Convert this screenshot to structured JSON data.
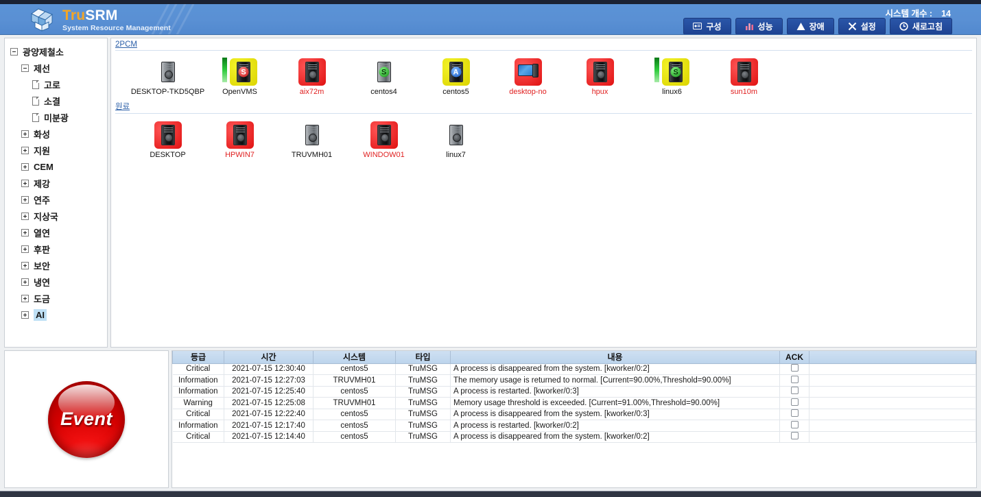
{
  "header": {
    "brand_tru": "Tru",
    "brand_srm": "SRM",
    "brand_sub": "System Resource Management",
    "system_count_label": "시스템 개수 :",
    "system_count_value": "14",
    "buttons": [
      {
        "label": "구성",
        "icon": "screen-icon",
        "active": false
      },
      {
        "label": "성능",
        "icon": "bar-chart-icon",
        "active": false
      },
      {
        "label": "장애",
        "icon": "warning-triangle-icon",
        "active": false
      },
      {
        "label": "설정",
        "icon": "tools-icon",
        "active": false
      },
      {
        "label": "새로고침",
        "icon": "refresh-icon",
        "active": true
      }
    ],
    "accent_color": "#5b93d6",
    "button_color": "#2a56a8",
    "active_underline_color": "#3ea8ff"
  },
  "sidebar": {
    "items": [
      {
        "label": "광양제철소",
        "level": 1,
        "marker": "minus",
        "selected": false
      },
      {
        "label": "제선",
        "level": 2,
        "marker": "minus",
        "selected": false
      },
      {
        "label": "고로",
        "level": 3,
        "marker": "document",
        "selected": false
      },
      {
        "label": "소결",
        "level": 3,
        "marker": "document",
        "selected": false
      },
      {
        "label": "미분광",
        "level": 3,
        "marker": "document",
        "selected": false
      },
      {
        "label": "화성",
        "level": 2,
        "marker": "plus",
        "selected": false
      },
      {
        "label": "지원",
        "level": 2,
        "marker": "plus",
        "selected": false
      },
      {
        "label": "CEM",
        "level": 2,
        "marker": "plus",
        "selected": false
      },
      {
        "label": "제강",
        "level": 2,
        "marker": "plus",
        "selected": false
      },
      {
        "label": "연주",
        "level": 2,
        "marker": "plus",
        "selected": false
      },
      {
        "label": "지상국",
        "level": 2,
        "marker": "plus",
        "selected": false
      },
      {
        "label": "열연",
        "level": 2,
        "marker": "plus",
        "selected": false
      },
      {
        "label": "후판",
        "level": 2,
        "marker": "plus",
        "selected": false
      },
      {
        "label": "보안",
        "level": 2,
        "marker": "plus",
        "selected": false
      },
      {
        "label": "냉연",
        "level": 2,
        "marker": "plus",
        "selected": false
      },
      {
        "label": "도금",
        "level": 2,
        "marker": "plus",
        "selected": false
      },
      {
        "label": "AI",
        "level": 2,
        "marker": "plus",
        "selected": true
      }
    ],
    "selection_color": "#bfe0f5"
  },
  "main": {
    "groups": [
      {
        "label": "2PCM",
        "systems": [
          {
            "name": "DESKTOP-TKD5QBP",
            "icon": "server-tower-icon",
            "bg": "none",
            "badge": "",
            "badge_color": "",
            "status_bar": false,
            "label_color": "black"
          },
          {
            "name": "OpenVMS",
            "icon": "server-tower-icon",
            "bg": "yellow",
            "badge": "S",
            "badge_color": "red",
            "status_bar": true,
            "label_color": "black"
          },
          {
            "name": "aix72m",
            "icon": "server-tower-icon",
            "bg": "red",
            "badge": "",
            "badge_color": "",
            "status_bar": false,
            "label_color": "red"
          },
          {
            "name": "centos4",
            "icon": "server-tower-icon",
            "bg": "none",
            "badge": "S",
            "badge_color": "green",
            "status_bar": false,
            "label_color": "black"
          },
          {
            "name": "centos5",
            "icon": "server-tower-icon",
            "bg": "yellow",
            "badge": "A",
            "badge_color": "blue",
            "status_bar": false,
            "label_color": "black"
          },
          {
            "name": "desktop-no",
            "icon": "desktop-monitor-icon",
            "bg": "red",
            "badge": "",
            "badge_color": "",
            "status_bar": false,
            "label_color": "red"
          },
          {
            "name": "hpux",
            "icon": "server-tower-icon",
            "bg": "red",
            "badge": "",
            "badge_color": "",
            "status_bar": false,
            "label_color": "red"
          },
          {
            "name": "linux6",
            "icon": "server-tower-icon",
            "bg": "yellow",
            "badge": "S",
            "badge_color": "green",
            "status_bar": true,
            "label_color": "black"
          },
          {
            "name": "sun10m",
            "icon": "server-tower-icon",
            "bg": "red",
            "badge": "",
            "badge_color": "",
            "status_bar": false,
            "label_color": "red"
          }
        ]
      },
      {
        "label": "원료",
        "systems": [
          {
            "name": "DESKTOP",
            "icon": "server-tower-icon",
            "bg": "red",
            "badge": "",
            "badge_color": "",
            "status_bar": false,
            "label_color": "black"
          },
          {
            "name": "HPWIN7",
            "icon": "server-tower-icon",
            "bg": "red",
            "badge": "",
            "badge_color": "",
            "status_bar": false,
            "label_color": "red"
          },
          {
            "name": "TRUVMH01",
            "icon": "server-tower-icon",
            "bg": "none",
            "badge": "",
            "badge_color": "",
            "status_bar": false,
            "label_color": "black"
          },
          {
            "name": "WINDOW01",
            "icon": "server-tower-icon",
            "bg": "red",
            "badge": "",
            "badge_color": "",
            "status_bar": false,
            "label_color": "red"
          },
          {
            "name": "linux7",
            "icon": "server-tower-icon",
            "bg": "none",
            "badge": "",
            "badge_color": "",
            "status_bar": false,
            "label_color": "black"
          }
        ]
      }
    ]
  },
  "events": {
    "button_label": "Event",
    "columns": [
      "등급",
      "시간",
      "시스템",
      "타입",
      "내용",
      "ACK",
      ""
    ],
    "rows": [
      {
        "level": "Critical",
        "time": "2021-07-15 12:30:40",
        "system": "centos5",
        "type": "TruMSG",
        "message": "A process is disappeared from the system.  [kworker/0:2]",
        "ack": false
      },
      {
        "level": "Information",
        "time": "2021-07-15 12:27:03",
        "system": "TRUVMH01",
        "type": "TruMSG",
        "message": "The memory usage is returned to normal.  [Current=90.00%,Threshold=90.00%]",
        "ack": false
      },
      {
        "level": "Information",
        "time": "2021-07-15 12:25:40",
        "system": "centos5",
        "type": "TruMSG",
        "message": "A process is restarted.  [kworker/0:3]",
        "ack": false
      },
      {
        "level": "Warning",
        "time": "2021-07-15 12:25:08",
        "system": "TRUVMH01",
        "type": "TruMSG",
        "message": "Memory usage threshold is exceeded.  [Current=91.00%,Threshold=90.00%]",
        "ack": false
      },
      {
        "level": "Critical",
        "time": "2021-07-15 12:22:40",
        "system": "centos5",
        "type": "TruMSG",
        "message": "A process is disappeared from the system.  [kworker/0:3]",
        "ack": false
      },
      {
        "level": "Information",
        "time": "2021-07-15 12:17:40",
        "system": "centos5",
        "type": "TruMSG",
        "message": "A process is restarted.  [kworker/0:2]",
        "ack": false
      },
      {
        "level": "Critical",
        "time": "2021-07-15 12:14:40",
        "system": "centos5",
        "type": "TruMSG",
        "message": "A process is disappeared from the system.  [kworker/0:2]",
        "ack": false
      }
    ],
    "colors": {
      "critical": "#e01010",
      "information": "#1a3fd0",
      "warning": "#f0a020"
    }
  }
}
